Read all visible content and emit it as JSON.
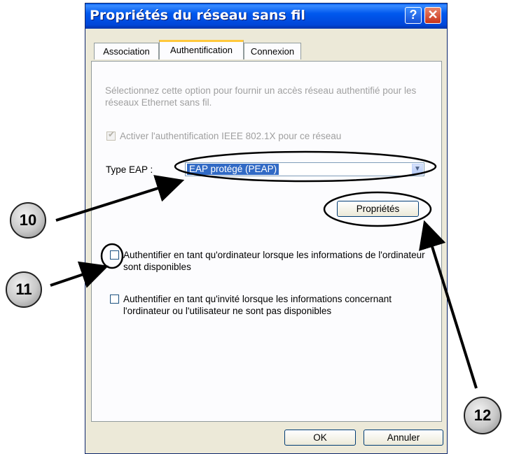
{
  "window": {
    "title": "Propriétés du réseau sans fil",
    "help_glyph": "?",
    "close_glyph": "✕"
  },
  "tabs": [
    {
      "label": "Association",
      "active": false
    },
    {
      "label": "Authentification",
      "active": true
    },
    {
      "label": "Connexion",
      "active": false
    }
  ],
  "auth": {
    "description": "Sélectionnez cette option pour fournir un accès réseau authentifié pour les réseaux Ethernet sans fil.",
    "enable_8021x_label": "Activer l'authentification IEEE 802.1X pour ce réseau",
    "enable_8021x_checked": true,
    "eap_type_label": "Type EAP :",
    "eap_type_value": "EAP protégé (PEAP)",
    "properties_button": "Propriétés",
    "computer_auth_label": "Authentifier en tant qu'ordinateur lorsque les informations de l'ordinateur sont disponibles",
    "computer_auth_checked": false,
    "guest_auth_label": "Authentifier en tant qu'invité lorsque les informations concernant l'ordinateur ou l'utilisateur ne sont pas disponibles",
    "guest_auth_checked": false
  },
  "footer": {
    "ok_button": "OK",
    "cancel_button": "Annuler"
  },
  "callouts": {
    "c10": "10",
    "c11": "11",
    "c12": "12"
  },
  "colors": {
    "titlebar": "#0058ee",
    "dialog_bg": "#ece9d8",
    "selection": "#316ac5",
    "tab_highlight": "#ffc83c"
  }
}
